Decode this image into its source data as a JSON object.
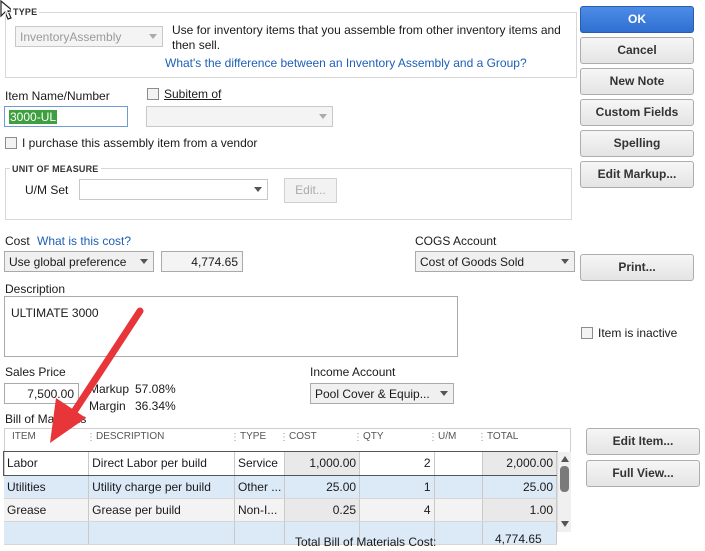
{
  "type_section": {
    "legend": "TYPE",
    "type_value": "InventoryAssembly",
    "description": "Use for inventory items that you assemble from other inventory items and then sell.",
    "link": "What's the difference between an Inventory Assembly and a Group?"
  },
  "item": {
    "name_label": "Item Name/Number",
    "name_value": "3000-UL",
    "subitem_label": "Subitem of",
    "purchase_label": "I purchase this assembly item from a vendor"
  },
  "uom": {
    "legend": "UNIT OF MEASURE",
    "set_label": "U/M Set",
    "edit_label": "Edit..."
  },
  "cost": {
    "label": "Cost",
    "link": "What is this cost?",
    "preference": "Use global preference",
    "value": "4,774.65",
    "cogs_label": "COGS Account",
    "cogs_value": "Cost of Goods Sold"
  },
  "description": {
    "label": "Description",
    "value": "ULTIMATE 3000"
  },
  "sales": {
    "price_label": "Sales Price",
    "price_value": "7,500.00",
    "markup_label": "Markup",
    "markup_value": "57.08%",
    "margin_label": "Margin",
    "margin_value": "36.34%",
    "income_label": "Income Account",
    "income_value": "Pool Cover & Equip..."
  },
  "inactive_label": "Item is inactive",
  "bom": {
    "label": "Bill of Materials",
    "columns": [
      "ITEM",
      "DESCRIPTION",
      "TYPE",
      "COST",
      "QTY",
      "U/M",
      "TOTAL"
    ],
    "rows": [
      {
        "item": "Labor",
        "description": "Direct Labor per build",
        "type": "Service",
        "cost": "1,000.00",
        "qty": "2",
        "um": "",
        "total": "2,000.00"
      },
      {
        "item": "Utilities",
        "description": "Utility charge per build",
        "type": "Other ...",
        "cost": "25.00",
        "qty": "1",
        "um": "",
        "total": "25.00"
      },
      {
        "item": "Grease",
        "description": "Grease per build",
        "type": "Non-I...",
        "cost": "0.25",
        "qty": "4",
        "um": "",
        "total": "1.00"
      }
    ],
    "total_label": "Total Bill of Materials Cost:",
    "total_value": "4,774.65"
  },
  "buttons": {
    "ok": "OK",
    "cancel": "Cancel",
    "new_note": "New Note",
    "custom_fields": "Custom Fields",
    "spelling": "Spelling",
    "edit_markup": "Edit Markup...",
    "print": "Print...",
    "edit_item": "Edit Item...",
    "full_view": "Full View..."
  },
  "colors": {
    "primary_button": "#3b7ddd",
    "link": "#1d5fb8",
    "arrow": "#e8353a",
    "selected_row": "#dce9f7"
  }
}
